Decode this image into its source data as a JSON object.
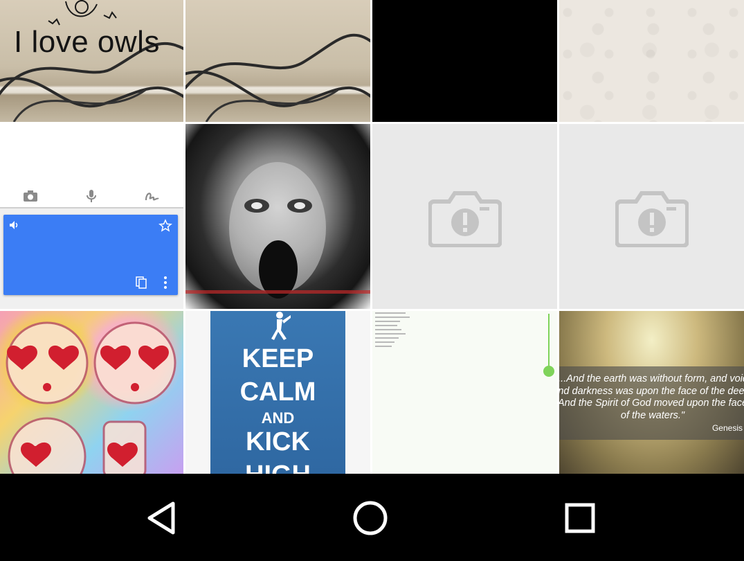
{
  "gallery": {
    "tiles": [
      {
        "id": "owls",
        "overlay_text": "I love owls"
      },
      {
        "id": "cables"
      },
      {
        "id": "black"
      },
      {
        "id": "pattern"
      },
      {
        "id": "translate-screenshot"
      },
      {
        "id": "scary-face"
      },
      {
        "id": "image-unavailable-1"
      },
      {
        "id": "image-unavailable-2"
      },
      {
        "id": "pop-art-letters"
      },
      {
        "id": "keep-calm-poster",
        "lines": [
          "KEEP",
          "CALM",
          "AND",
          "KICK",
          "HIGH"
        ]
      },
      {
        "id": "notes-screenshot"
      },
      {
        "id": "genesis-verse",
        "verse": "\"...And the earth was without form, and void; and darkness was upon the face of the deep. And the Spirit of God moved upon the face of the waters.\"",
        "source": "Genesis"
      }
    ]
  },
  "icons": {
    "translate_toolbar": [
      "camera-icon",
      "microphone-icon",
      "handwriting-icon"
    ],
    "translate_card": [
      "speaker-icon",
      "star-icon",
      "copy-icon",
      "more-vert-icon"
    ],
    "placeholder": "camera-error-icon"
  },
  "navbar": {
    "buttons": [
      "back-icon",
      "home-icon",
      "recents-icon"
    ]
  },
  "colors": {
    "navbar_bg": "#000000",
    "translate_card": "#3b7df5",
    "placeholder_bg": "#e9e9e9",
    "placeholder_icon": "#c4c4c4",
    "accent_green": "#7fd35a"
  }
}
